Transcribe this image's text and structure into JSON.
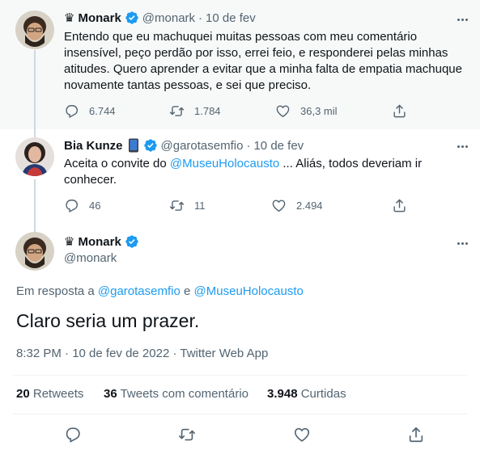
{
  "tweets": [
    {
      "crown": "♛",
      "name": "Monark",
      "handle": "@monark",
      "sep": "·",
      "date": "10 de fev",
      "lines": [
        "Entendo que eu machuquei muitas pessoas com meu comentário",
        "insensível, peço perdão por isso, errei feio, e responderei pelas minhas",
        "atitudes. Quero aprender a evitar que a minha falta de empatia machuque",
        "novamente tantas pessoas, e sei que preciso."
      ],
      "replies": "6.744",
      "retweets": "1.784",
      "likes": "36,3 mil"
    },
    {
      "name": "Bia Kunze",
      "emoji_icon": "phone-icon",
      "handle": "@garotasemfio",
      "sep": "·",
      "date": "10 de fev",
      "line1_pre": "Aceita o convite do ",
      "line1_link": "@MuseuHolocausto",
      "line1_post": " ... Aliás, todos deveriam ir",
      "line2": "conhecer.",
      "replies": "46",
      "retweets": "11",
      "likes": "2.494"
    }
  ],
  "main_tweet": {
    "crown": "♛",
    "name": "Monark",
    "handle": "@monark",
    "reply_prefix": "Em resposta a ",
    "reply_to_1": "@garotasemfio",
    "reply_and": " e ",
    "reply_to_2": "@MuseuHolocausto",
    "text": "Claro seria um prazer.",
    "timestamp": "8:32 PM · 10 de fev de 2022 · Twitter Web App",
    "stats": {
      "retweets_count": "20",
      "retweets_label": "Retweets",
      "quotes_count": "36",
      "quotes_label": "Tweets com comentário",
      "likes_count": "3.948",
      "likes_label": "Curtidas"
    }
  },
  "colors": {
    "link": "#1d9bf0",
    "secondary_text": "#536471",
    "verified": "#1d9bf0",
    "highlight_bg": "#f7f9f9"
  },
  "icons": [
    "more-icon",
    "verified-icon",
    "reply-icon",
    "retweet-icon",
    "like-icon",
    "share-icon",
    "phone-icon"
  ]
}
